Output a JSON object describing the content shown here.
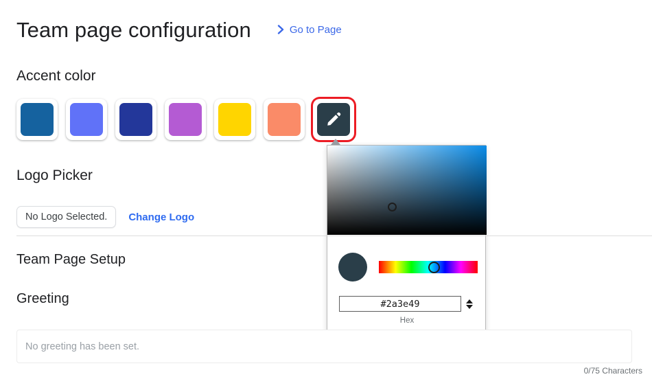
{
  "header": {
    "title": "Team page configuration",
    "goto_link_label": "Go to Page",
    "goto_icon": "chevron-right-icon",
    "link_color": "#3b68e8"
  },
  "accent_color": {
    "heading": "Accent color",
    "swatches": [
      {
        "name": "swatch-blue",
        "hex": "#15629f"
      },
      {
        "name": "swatch-periwinkle",
        "hex": "#6072f8"
      },
      {
        "name": "swatch-navy",
        "hex": "#23379a"
      },
      {
        "name": "swatch-purple",
        "hex": "#b45bd3"
      },
      {
        "name": "swatch-yellow",
        "hex": "#ffd500"
      },
      {
        "name": "swatch-salmon",
        "hex": "#fa8b68"
      }
    ],
    "custom_swatch": {
      "name": "custom-color-edit",
      "hex": "#2a3e49",
      "icon": "pencil-icon",
      "selected": true,
      "focus_ring_color": "#ec1c24"
    }
  },
  "color_picker": {
    "selected_hex": "#2a3e49",
    "hue_position_pct": 56,
    "saturation_pct": 41,
    "value_pct": 31,
    "hue_color": "#0a8ce8",
    "hex_input_value": "#2a3e49",
    "hex_input_label": "Hex",
    "stepper_up_icon": "triangle-up-icon",
    "stepper_down_icon": "triangle-down-icon"
  },
  "logo_picker": {
    "heading": "Logo Picker",
    "status_text": "No Logo Selected.",
    "change_label": "Change Logo"
  },
  "team_page_setup": {
    "heading": "Team Page Setup"
  },
  "greeting": {
    "heading": "Greeting",
    "placeholder": "No greeting has been set.",
    "value": "",
    "char_count": "0/75 Characters"
  }
}
